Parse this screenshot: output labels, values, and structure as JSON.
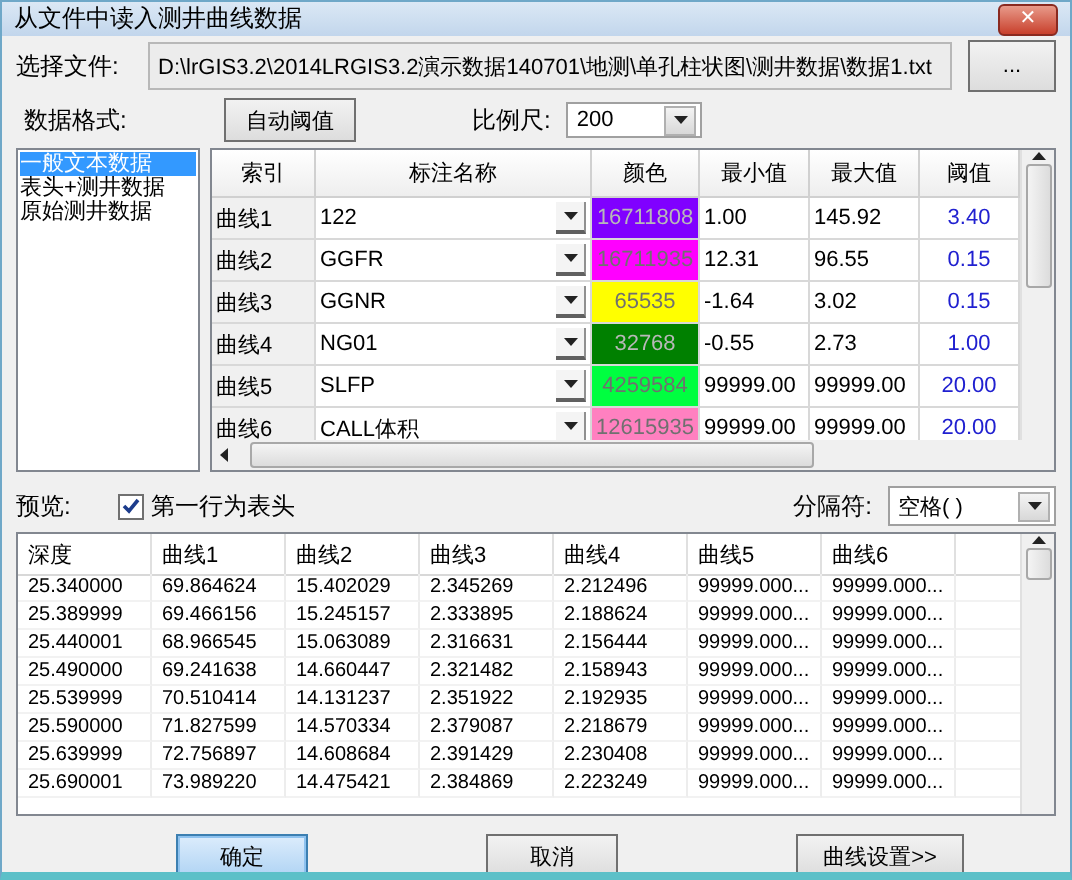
{
  "window": {
    "title": "从文件中读入测井曲线数据",
    "close": "✕"
  },
  "file": {
    "label": "选择文件:",
    "path": "D:\\lrGIS3.2\\2014LRGIS3.2演示数据140701\\地测\\单孔柱状图\\测井数据\\数据1.txt",
    "browse": "..."
  },
  "format_label": "数据格式:",
  "auto_threshold_button": "自动阈值",
  "scale": {
    "label": "比例尺:",
    "value": "200"
  },
  "formats": [
    {
      "label": "一般文本数据",
      "selected": true
    },
    {
      "label": "表头+测井数据",
      "selected": false
    },
    {
      "label": "原始测井数据",
      "selected": false
    }
  ],
  "curve_table": {
    "columns": [
      "索引",
      "标注名称",
      "颜色",
      "最小值",
      "最大值",
      "阈值"
    ],
    "rows": [
      {
        "index": "曲线1",
        "name": "122",
        "color": "#8000ff",
        "color_value": "16711808",
        "min": "1.00",
        "max": "145.92",
        "threshold": "3.40"
      },
      {
        "index": "曲线2",
        "name": "GGFR",
        "color": "#ff00ff",
        "color_value": "16711935",
        "min": "12.31",
        "max": "96.55",
        "threshold": "0.15"
      },
      {
        "index": "曲线3",
        "name": "GGNR",
        "color": "#ffff00",
        "color_value": "65535",
        "min": "-1.64",
        "max": "3.02",
        "threshold": "0.15"
      },
      {
        "index": "曲线4",
        "name": "NG01",
        "color": "#008000",
        "color_value": "32768",
        "min": "-0.55",
        "max": "2.73",
        "threshold": "1.00"
      },
      {
        "index": "曲线5",
        "name": "SLFP",
        "color": "#00ff40",
        "color_value": "4259584",
        "min": "99999.00",
        "max": "99999.00",
        "threshold": "20.00"
      },
      {
        "index": "曲线6",
        "name": "CALL体积",
        "color": "#ff80c0",
        "color_value": "12615935",
        "min": "99999.00",
        "max": "99999.00",
        "threshold": "20.00"
      }
    ]
  },
  "preview": {
    "label": "预览:",
    "header_checkbox": {
      "label": "第一行为表头",
      "checked": true
    },
    "separator": {
      "label": "分隔符:",
      "value": "空格( )"
    },
    "table": {
      "columns": [
        "深度",
        "曲线1",
        "曲线2",
        "曲线3",
        "曲线4",
        "曲线5",
        "曲线6"
      ],
      "rows": [
        [
          "25.340000",
          "69.864624",
          "15.402029",
          "2.345269",
          "2.212496",
          "99999.000...",
          "99999.000..."
        ],
        [
          "25.389999",
          "69.466156",
          "15.245157",
          "2.333895",
          "2.188624",
          "99999.000...",
          "99999.000..."
        ],
        [
          "25.440001",
          "68.966545",
          "15.063089",
          "2.316631",
          "2.156444",
          "99999.000...",
          "99999.000..."
        ],
        [
          "25.490000",
          "69.241638",
          "14.660447",
          "2.321482",
          "2.158943",
          "99999.000...",
          "99999.000..."
        ],
        [
          "25.539999",
          "70.510414",
          "14.131237",
          "2.351922",
          "2.192935",
          "99999.000...",
          "99999.000..."
        ],
        [
          "25.590000",
          "71.827599",
          "14.570334",
          "2.379087",
          "2.218679",
          "99999.000...",
          "99999.000..."
        ],
        [
          "25.639999",
          "72.756897",
          "14.608684",
          "2.391429",
          "2.230408",
          "99999.000...",
          "99999.000..."
        ],
        [
          "25.690001",
          "73.989220",
          "14.475421",
          "2.384869",
          "2.223249",
          "99999.000...",
          "99999.000..."
        ]
      ]
    }
  },
  "buttons": [
    {
      "label": "确定",
      "selected": true
    },
    {
      "label": "取消",
      "selected": false
    },
    {
      "label": "曲线设置>>",
      "selected": false
    }
  ]
}
